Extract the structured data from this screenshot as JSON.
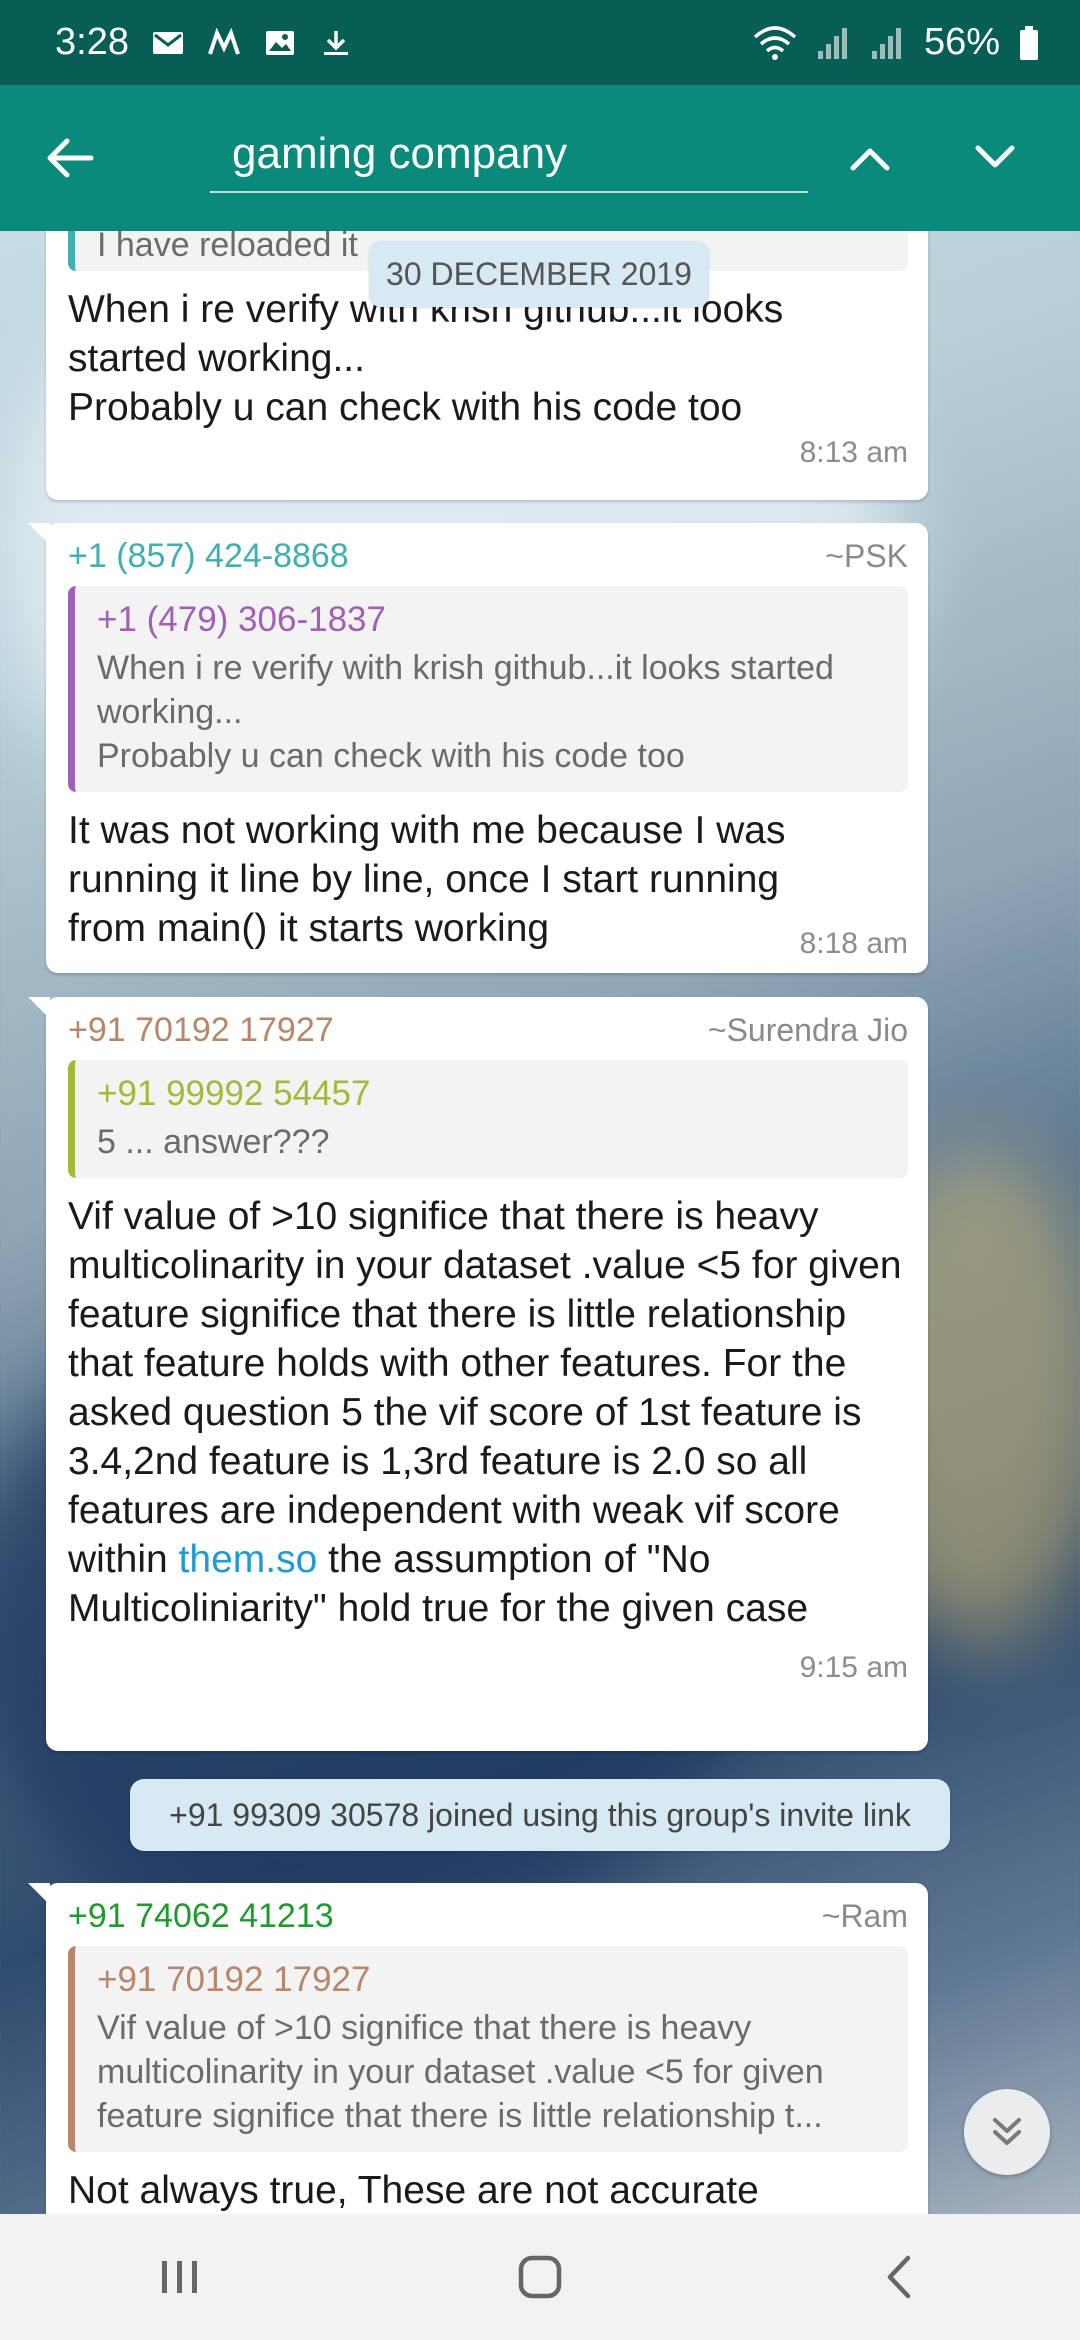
{
  "status_bar": {
    "time": "3:28",
    "battery": "56%",
    "left_icons": [
      "gmail-icon",
      "moto-icon",
      "gallery-icon",
      "download-icon"
    ],
    "right_icons": [
      "wifi-icon",
      "signal-icon",
      "signal-icon-2",
      "battery-icon"
    ]
  },
  "toolbar": {
    "search_value": "gaming company",
    "back_icon": "arrow-left-icon",
    "up_icon": "chevron-up-icon",
    "down_icon": "chevron-down-icon",
    "color": "#0a8a7a"
  },
  "chat": {
    "date_chip": "30 DECEMBER 2019",
    "messages": [
      {
        "quote_text_partial": "I have reloaded it",
        "text": "When i re verify with krish github...it looks started working...\nProbably u can check with his code too",
        "time": "8:13 am"
      },
      {
        "sender": "+1 (857) 424-8868",
        "sender_color": "#3fb0b0",
        "alias": "~PSK",
        "quote": {
          "sender": "+1 (479) 306-1837",
          "sender_color": "#a25fb6",
          "text": "When i re verify with krish github...it looks started working...\nProbably u can check with his code too"
        },
        "text": "It was not working with me because I was running it line by line, once I start running from main() it starts working",
        "time": "8:18 am"
      },
      {
        "sender": "+91 70192 17927",
        "sender_color": "#b8866a",
        "alias": "~Surendra Jio",
        "quote": {
          "sender": "+91 99992 54457",
          "sender_color": "#a6b83a",
          "text": "5 ... answer???"
        },
        "text_before_link": "Vif value of >10 significe that there is heavy multicolinarity in your dataset .value <5 for given feature significe that there is little relationship that feature holds with other features. For the asked question 5 the vif score of 1st feature is 3.4,2nd feature is 1,3rd feature is 2.0 so all features are independent with weak vif score within ",
        "link": "them.so",
        "text_after_link": " the assumption of \"No Multicoliniarity\" hold true for the given case",
        "time": "9:15 am"
      },
      {
        "system": "+91 99309 30578 joined using this group's invite link"
      },
      {
        "sender": "+91 74062 41213",
        "sender_color": "#1f9a2e",
        "alias": "~Ram",
        "quote": {
          "sender": "+91 70192 17927",
          "sender_color": "#b8866a",
          "text": "Vif value of >10 significe that there is heavy multicolinarity in your dataset .value <5 for given feature significe that there is little relationship t..."
        },
        "text": "Not always true, These are not accurate"
      }
    ]
  },
  "fab": {
    "icon": "double-chevron-down-icon"
  },
  "nav_bar": {
    "icons": [
      "recent-apps-icon",
      "home-icon",
      "back-icon"
    ]
  }
}
